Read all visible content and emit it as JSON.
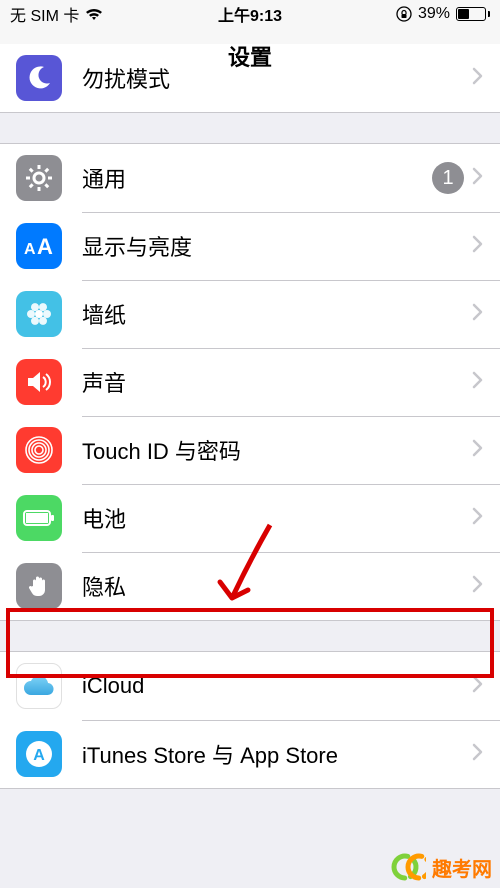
{
  "status": {
    "carrier": "无 SIM 卡",
    "time": "上午9:13",
    "battery_pct": "39%"
  },
  "nav": {
    "title": "设置"
  },
  "groups": [
    {
      "cells": [
        {
          "key": "dnd",
          "label": "勿扰模式",
          "icon": "moon",
          "color": "#5856d6"
        }
      ]
    },
    {
      "cells": [
        {
          "key": "general",
          "label": "通用",
          "icon": "gear",
          "color": "#8e8e93",
          "badge": "1"
        },
        {
          "key": "display",
          "label": "显示与亮度",
          "icon": "aa",
          "color": "#007aff"
        },
        {
          "key": "wallpaper",
          "label": "墙纸",
          "icon": "flower",
          "color": "#43c1e6"
        },
        {
          "key": "sound",
          "label": "声音",
          "icon": "speaker",
          "color": "#ff3b30"
        },
        {
          "key": "touchid",
          "label": "Touch ID 与密码",
          "icon": "fingerprint",
          "color": "#ff3b30"
        },
        {
          "key": "battery",
          "label": "电池",
          "icon": "battery",
          "color": "#4cd964"
        },
        {
          "key": "privacy",
          "label": "隐私",
          "icon": "hand",
          "color": "#8e8e93"
        }
      ]
    },
    {
      "cells": [
        {
          "key": "icloud",
          "label": "iCloud",
          "icon": "cloud",
          "color": "#ffffff"
        },
        {
          "key": "itunes",
          "label": "iTunes Store 与 App Store",
          "icon": "appstore",
          "color": "#24a8ef"
        }
      ]
    }
  ],
  "watermark": "趣考网"
}
